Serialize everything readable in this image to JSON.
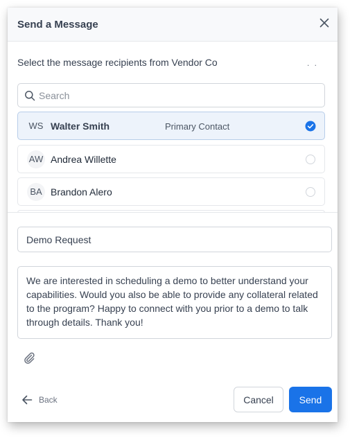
{
  "dialog": {
    "title": "Send a Message",
    "instruction": "Select the message recipients from Vendor Co",
    "more_label": ". ."
  },
  "search": {
    "placeholder": "Search",
    "value": ""
  },
  "recipients": [
    {
      "initials": "WS",
      "name": "Walter Smith",
      "role": "Primary Contact",
      "selected": true
    },
    {
      "initials": "AW",
      "name": "Andrea Willette",
      "role": "",
      "selected": false
    },
    {
      "initials": "BA",
      "name": "Brandon Alero",
      "role": "",
      "selected": false
    }
  ],
  "form": {
    "subject": "Demo Request",
    "message": "We are interested in scheduling a demo to better understand your capabilities. Would you also be able to provide any collateral related to the program? Happy to connect with you prior to a demo to talk through details. Thank you!"
  },
  "footer": {
    "back_label": "Back",
    "cancel_label": "Cancel",
    "send_label": "Send"
  },
  "colors": {
    "accent": "#1a73e8",
    "selected_row": "#edf3fb"
  }
}
